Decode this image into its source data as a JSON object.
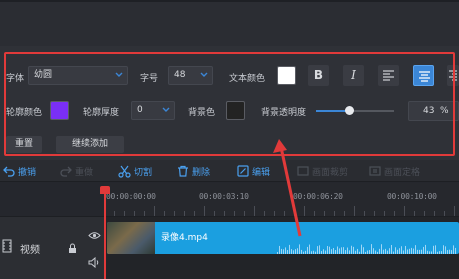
{
  "colors": {
    "accent_blue": "#3b86d6",
    "highlight_red": "#e13a3a",
    "outline_color": "#7a2ff5",
    "text_color": "#ffffff",
    "bg_color": "#232323"
  },
  "text_panel": {
    "font_label": "字体",
    "font_value": "幼圆",
    "size_label": "字号",
    "size_value": "48",
    "text_color_label": "文本颜色",
    "outline_color_label": "轮廓颜色",
    "outline_thickness_label": "轮廓厚度",
    "outline_thickness_value": "0",
    "bg_color_label": "背景色",
    "bg_opacity_label": "背景透明度",
    "bg_opacity_value": "43",
    "bg_opacity_unit": "%",
    "bg_opacity_fraction": 0.43,
    "bold_glyph": "B",
    "italic_glyph": "I",
    "reset_button": "重置",
    "continue_add_button": "继续添加"
  },
  "toolbar": {
    "undo": "撤销",
    "redo": "重做",
    "cut": "切割",
    "delete": "删除",
    "edit": "编辑",
    "frame_crop": "画面裁剪",
    "frame_lock": "画面定格"
  },
  "timeline": {
    "ruler_labels": [
      "00:00:00:00",
      "00:00:03:10",
      "00:00:06:20",
      "00:00:10:00"
    ],
    "track_label": "视频",
    "clip_name": "录像4.mp4"
  }
}
